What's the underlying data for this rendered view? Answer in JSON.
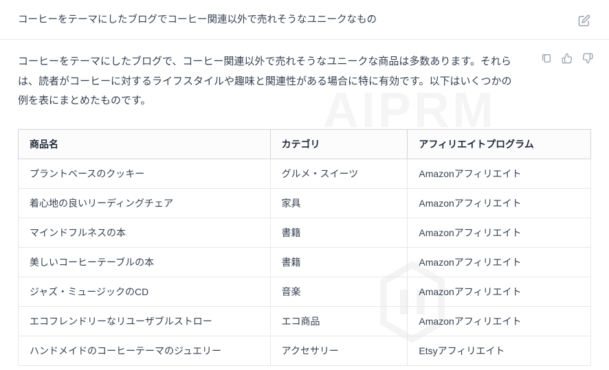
{
  "watermark": "AIPRM",
  "prompt": {
    "text": "コーヒーをテーマにしたブログでコーヒー関連以外で売れそうなユニークなもの"
  },
  "actions": {
    "copy_label": "copy",
    "like_label": "like",
    "dislike_label": "dislike"
  },
  "response": {
    "intro": "コーヒーをテーマにしたブログで、コーヒー関連以外で売れそうなユニークな商品は多数あります。それらは、読者がコーヒーに対するライフスタイルや趣味と関連性がある場合に特に有効です。以下はいくつかの例を表にまとめたものです。",
    "table": {
      "headers": [
        "商品名",
        "カテゴリ",
        "アフィリエイトプログラム"
      ],
      "rows": [
        [
          "プラントベースのクッキー",
          "グルメ・スイーツ",
          "Amazonアフィリエイト"
        ],
        [
          "着心地の良いリーディングチェア",
          "家具",
          "Amazonアフィリエイト"
        ],
        [
          "マインドフルネスの本",
          "書籍",
          "Amazonアフィリエイト"
        ],
        [
          "美しいコーヒーテーブルの本",
          "書籍",
          "Amazonアフィリエイト"
        ],
        [
          "ジャズ・ミュージックのCD",
          "音楽",
          "Amazonアフィリエイト"
        ],
        [
          "エコフレンドリーなリユーザブルストロー",
          "エコ商品",
          "Amazonアフィリエイト"
        ],
        [
          "ハンドメイドのコーヒーテーマのジュエリー",
          "アクセサリー",
          "Etsyアフィリエイト"
        ]
      ]
    }
  }
}
